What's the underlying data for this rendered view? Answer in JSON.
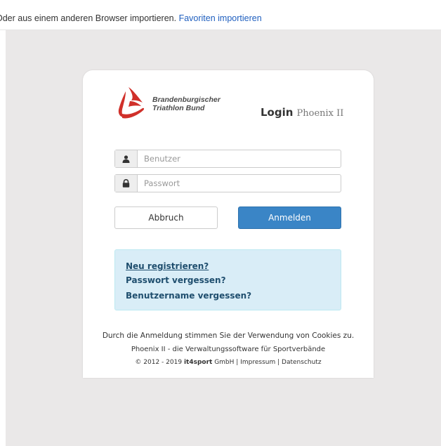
{
  "topbar": {
    "message": "Oder aus einem anderen Browser importieren.",
    "link": "Favoriten importieren"
  },
  "brand": {
    "line1": "Brandenburgischer",
    "line2": "Triathlon Bund",
    "color": "#d0302a"
  },
  "login": {
    "title": "Login",
    "subtitle": "Phoenix II",
    "username_placeholder": "Benutzer",
    "password_placeholder": "Passwort",
    "user_icon": "user-icon",
    "lock_icon": "lock-icon",
    "cancel_label": "Abbruch",
    "submit_label": "Anmelden",
    "submit_color": "#3a85c6"
  },
  "links": {
    "register": "Neu registrieren?",
    "forgot_password": "Passwort vergessen?",
    "forgot_username": "Benutzername vergessen?"
  },
  "footer": {
    "cookies": "Durch die Anmeldung stimmen Sie der Verwendung von Cookies zu.",
    "tagline": "Phoenix II - die Verwaltungssoftware für Sportverbände",
    "copyright": "© 2012 - 2019",
    "company_bold": "it4sport",
    "company_rest": "GmbH",
    "separator": "|",
    "impressum": "Impressum",
    "datenschutz": "Datenschutz"
  }
}
